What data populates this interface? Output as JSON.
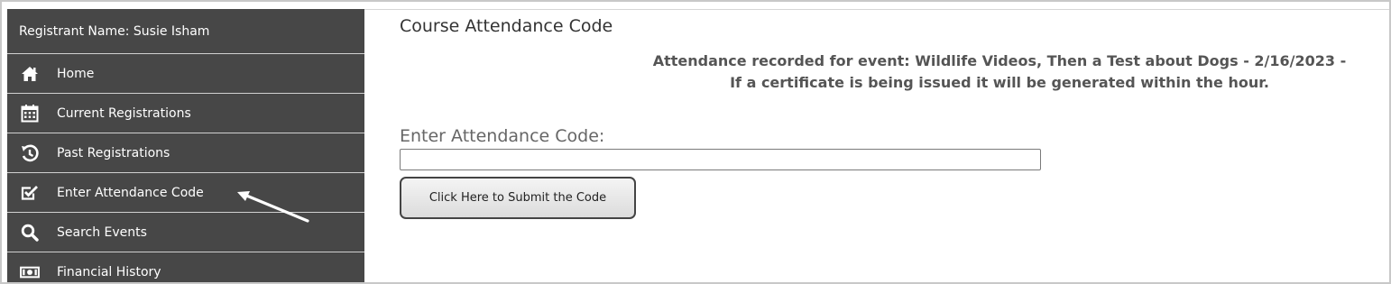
{
  "sidebar": {
    "registrant": "Registrant Name: Susie Isham",
    "items": [
      {
        "label": "Home",
        "icon": "home-icon"
      },
      {
        "label": "Current Registrations",
        "icon": "calendar-icon"
      },
      {
        "label": "Past Registrations",
        "icon": "history-icon"
      },
      {
        "label": "Enter Attendance Code",
        "icon": "checkbox-icon"
      },
      {
        "label": "Search Events",
        "icon": "search-icon"
      },
      {
        "label": "Financial History",
        "icon": "money-icon"
      }
    ]
  },
  "main": {
    "title": "Course Attendance Code",
    "notice_line1": "Attendance recorded for event: Wildlife Videos, Then a Test about Dogs - 2/16/2023 -",
    "notice_line2": "If a certificate is being issued it will be generated within the hour.",
    "code_label": "Enter Attendance Code:",
    "code_value": "",
    "submit_label": "Click Here to Submit the Code"
  },
  "colors": {
    "sidebar_bg": "#474747",
    "sidebar_text": "#ffffff",
    "annotation_arrow": "#ffffff"
  }
}
